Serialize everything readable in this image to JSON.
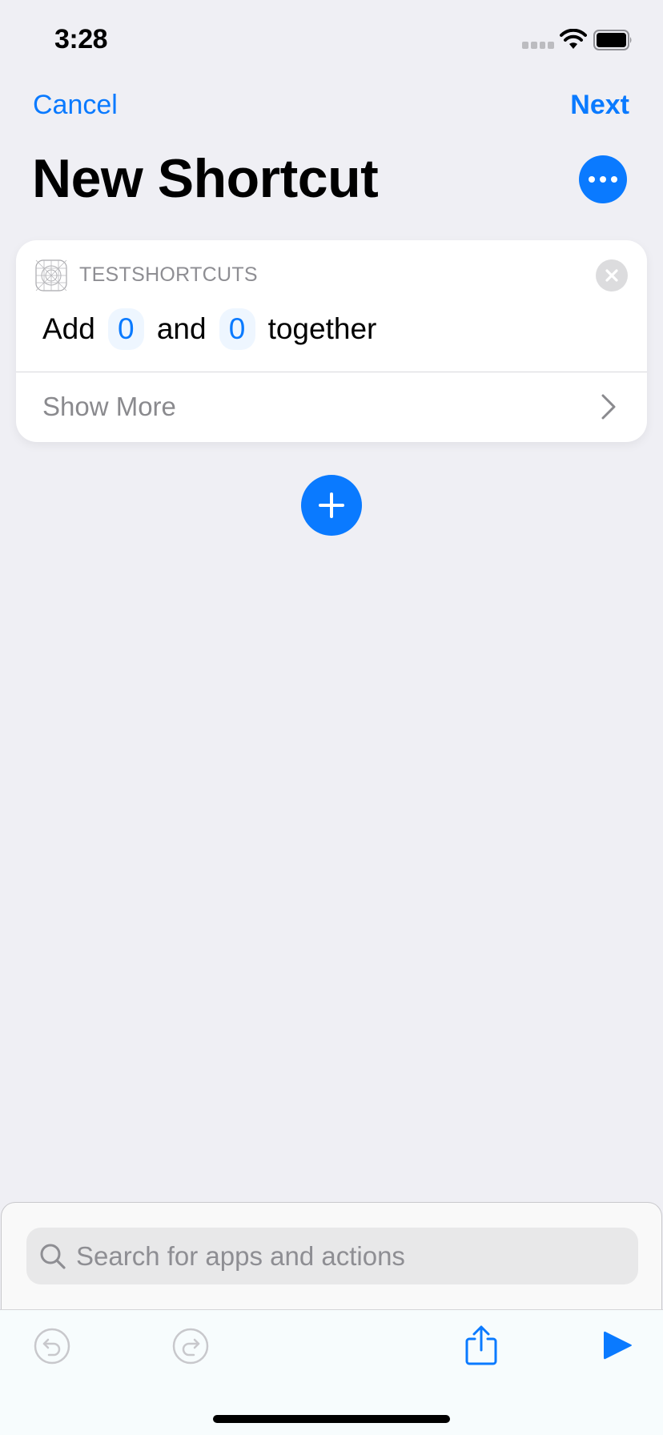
{
  "status_bar": {
    "time": "3:28",
    "signal_icon": "cellular-signal-icon",
    "wifi_icon": "wifi-icon",
    "battery_icon": "battery-icon"
  },
  "nav": {
    "cancel_label": "Cancel",
    "next_label": "Next",
    "title": "New Shortcut",
    "more_icon": "ellipsis-circle-icon"
  },
  "action_card": {
    "app_name": "TESTSHORTCUTS",
    "app_icon": "app-placeholder-grid-icon",
    "words": [
      "Add",
      "and",
      "together"
    ],
    "params": [
      "0",
      "0"
    ],
    "show_more_label": "Show More",
    "close_icon": "close-circle-icon",
    "chevron_icon": "chevron-right-icon"
  },
  "add_action_icon": "plus-circle-icon",
  "search": {
    "placeholder": "Search for apps and actions",
    "value": ""
  },
  "toolbar": {
    "undo_icon": "undo-icon",
    "redo_icon": "redo-icon",
    "share_icon": "share-icon",
    "play_icon": "play-icon"
  },
  "colors": {
    "accent": "#0a7aff",
    "background": "#efeff4",
    "secondary_text": "#8e8e93"
  }
}
